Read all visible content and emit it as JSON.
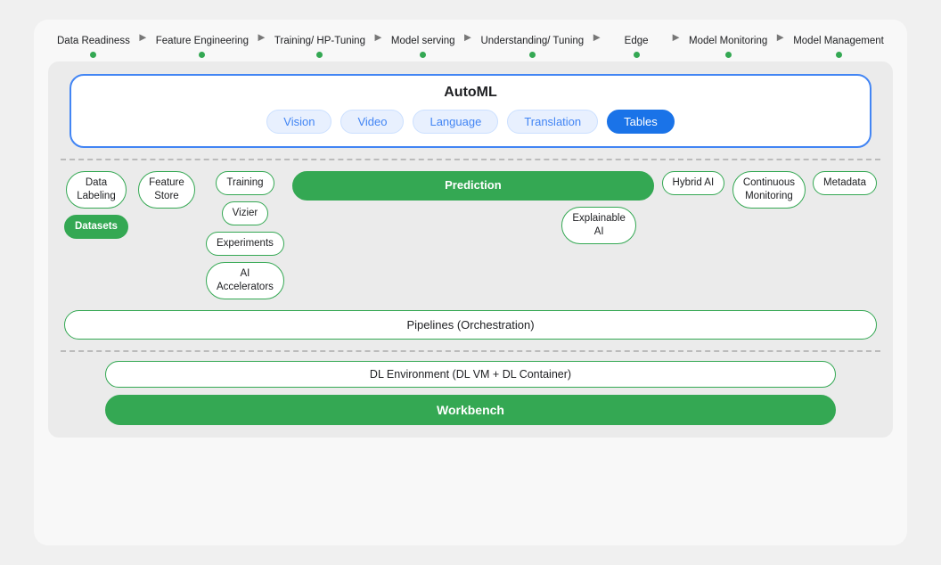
{
  "header": {
    "steps": [
      {
        "id": "data-readiness",
        "label": "Data\nReadiness",
        "hasDot": true
      },
      {
        "id": "feature-engineering",
        "label": "Feature\nEngineering",
        "hasDot": true
      },
      {
        "id": "training",
        "label": "Training/\nHP-Tuning",
        "hasDot": true
      },
      {
        "id": "model-serving",
        "label": "Model\nserving",
        "hasDot": true
      },
      {
        "id": "understanding",
        "label": "Understanding/\nTuning",
        "hasDot": true
      },
      {
        "id": "edge",
        "label": "Edge",
        "hasDot": true
      },
      {
        "id": "model-monitoring",
        "label": "Model\nMonitoring",
        "hasDot": true
      },
      {
        "id": "model-management",
        "label": "Model\nManagement",
        "hasDot": true
      }
    ]
  },
  "automl": {
    "title": "AutoML",
    "tabs": [
      {
        "id": "vision",
        "label": "Vision",
        "active": false
      },
      {
        "id": "video",
        "label": "Video",
        "active": false
      },
      {
        "id": "language",
        "label": "Language",
        "active": false
      },
      {
        "id": "translation",
        "label": "Translation",
        "active": false
      },
      {
        "id": "tables",
        "label": "Tables",
        "active": true
      }
    ]
  },
  "middle": {
    "col1": [
      {
        "id": "data-labeling",
        "label": "Data\nLabeling",
        "fill": false
      },
      {
        "id": "datasets",
        "label": "Datasets",
        "fill": true
      }
    ],
    "col2": [
      {
        "id": "feature-store",
        "label": "Feature\nStore",
        "fill": false
      }
    ],
    "col3": [
      {
        "id": "training",
        "label": "Training",
        "fill": false
      },
      {
        "id": "vizier",
        "label": "Vizier",
        "fill": false
      },
      {
        "id": "experiments",
        "label": "Experiments",
        "fill": false
      },
      {
        "id": "ai-accelerators",
        "label": "AI\nAccelerators",
        "fill": false
      }
    ],
    "col4": [
      {
        "id": "prediction",
        "label": "Prediction",
        "fill": true
      },
      {
        "id": "explainable-ai",
        "label": "Explainable\nAI",
        "fill": false
      }
    ],
    "col5": [
      {
        "id": "hybrid-ai",
        "label": "Hybrid AI",
        "fill": false
      }
    ],
    "col6": [
      {
        "id": "continuous-monitoring",
        "label": "Continuous\nMonitoring",
        "fill": false
      }
    ],
    "col7": [
      {
        "id": "metadata",
        "label": "Metadata",
        "fill": false
      }
    ]
  },
  "pipelines": {
    "label": "Pipelines (Orchestration)"
  },
  "bottom": {
    "dl_env_label": "DL Environment (DL VM + DL Container)",
    "workbench_label": "Workbench"
  }
}
